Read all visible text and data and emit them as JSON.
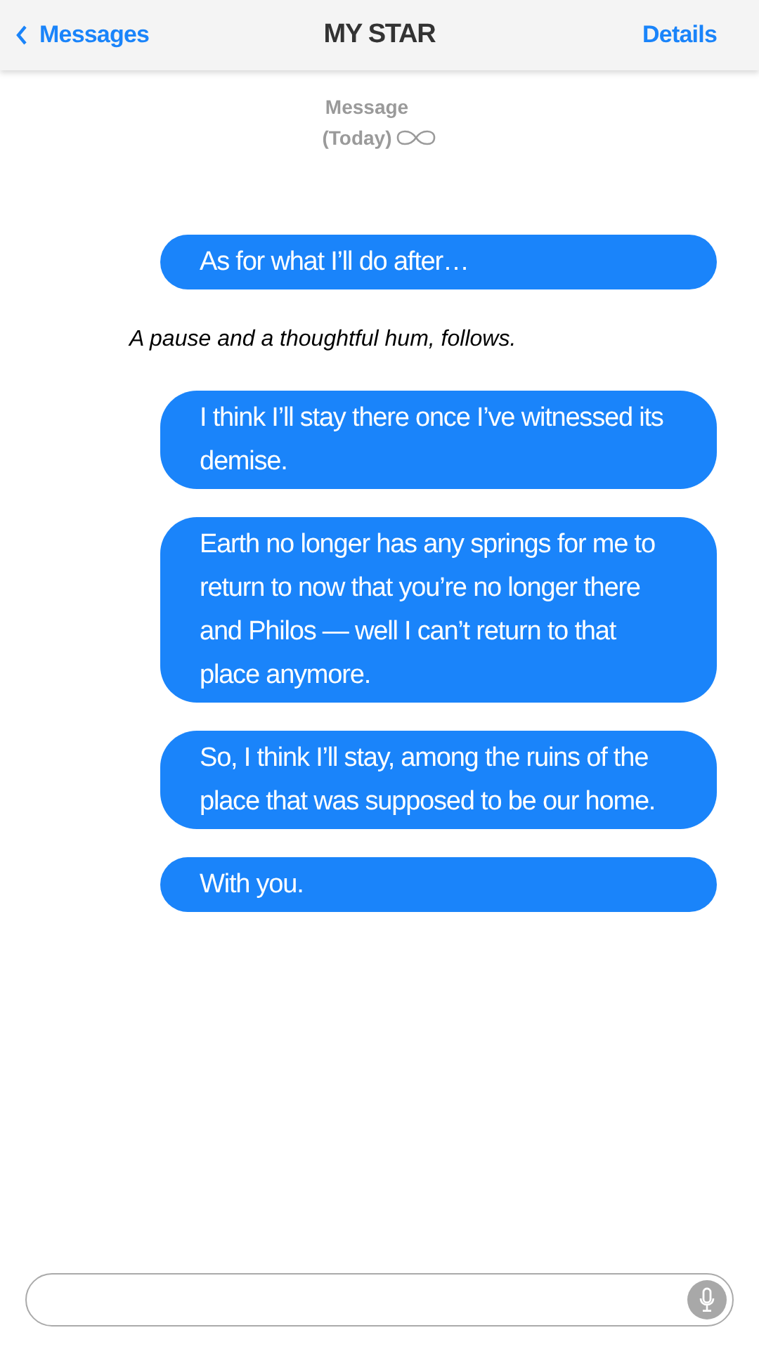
{
  "header": {
    "back_label": "Messages",
    "title": "MY STAR",
    "action": "Details"
  },
  "timestamp": {
    "label": "Message",
    "date": "(Today)"
  },
  "messages": [
    {
      "kind": "bubble",
      "text": "As for what I’ll do after…"
    },
    {
      "kind": "narration",
      "text": "A pause and a thoughtful hum, follows."
    },
    {
      "kind": "bubble",
      "text": "I think I’ll stay there once I’ve witnessed its demise."
    },
    {
      "kind": "bubble",
      "text": "Earth no longer has any springs for me to return to now that you’re no longer there and Philos — well I can’t return to that place anymore."
    },
    {
      "kind": "bubble",
      "text": "So, I think I’ll stay, among the ruins of the place that was supposed to be our home."
    },
    {
      "kind": "bubble",
      "text": "With you."
    }
  ]
}
